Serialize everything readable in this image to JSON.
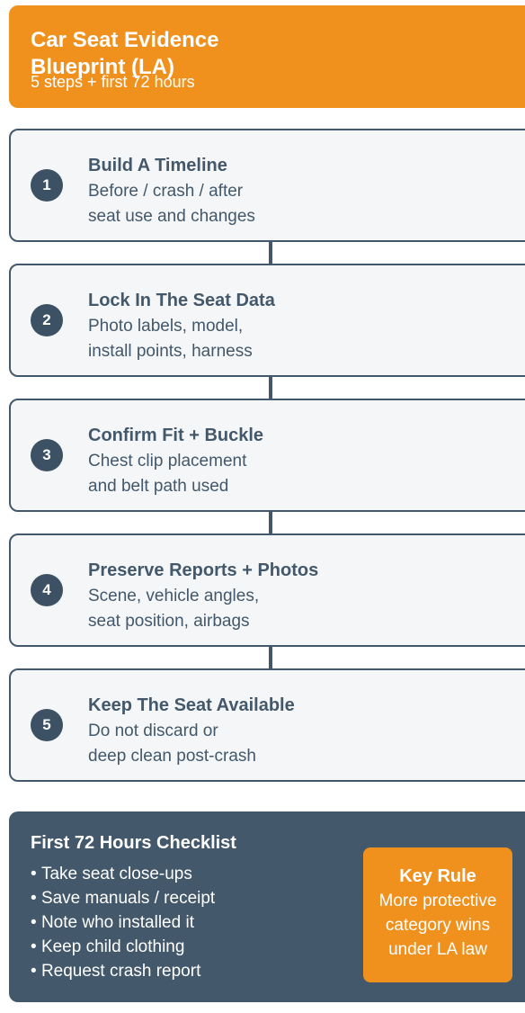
{
  "header": {
    "title": "Car Seat Evidence Blueprint (LA)",
    "subtitle": "5 steps + first 72 hours"
  },
  "steps": [
    {
      "number": "1",
      "title": "Build A Timeline",
      "line1": "Before / crash / after",
      "line2": "seat use and changes"
    },
    {
      "number": "2",
      "title": "Lock In The Seat Data",
      "line1": "Photo labels, model,",
      "line2": "install points, harness"
    },
    {
      "number": "3",
      "title": "Confirm Fit + Buckle",
      "line1": "Chest clip placement",
      "line2": "and belt path used"
    },
    {
      "number": "4",
      "title": "Preserve Reports + Photos",
      "line1": "Scene, vehicle angles,",
      "line2": "seat position, airbags"
    },
    {
      "number": "5",
      "title": "Keep The Seat Available",
      "line1": "Do not discard or",
      "line2": "deep clean post-crash"
    }
  ],
  "checklist": {
    "title": "First 72 Hours Checklist",
    "items": [
      "Take seat close-ups",
      "Save manuals / receipt",
      "Note who installed it",
      "Keep child clothing",
      "Request crash report"
    ]
  },
  "key_rule": {
    "title": "Key Rule",
    "lines": [
      "More protective",
      "category wins",
      "under LA law"
    ]
  },
  "colors": {
    "accent": "#f0911e",
    "slate": "#43586a",
    "card_bg": "#f4f6f8"
  }
}
